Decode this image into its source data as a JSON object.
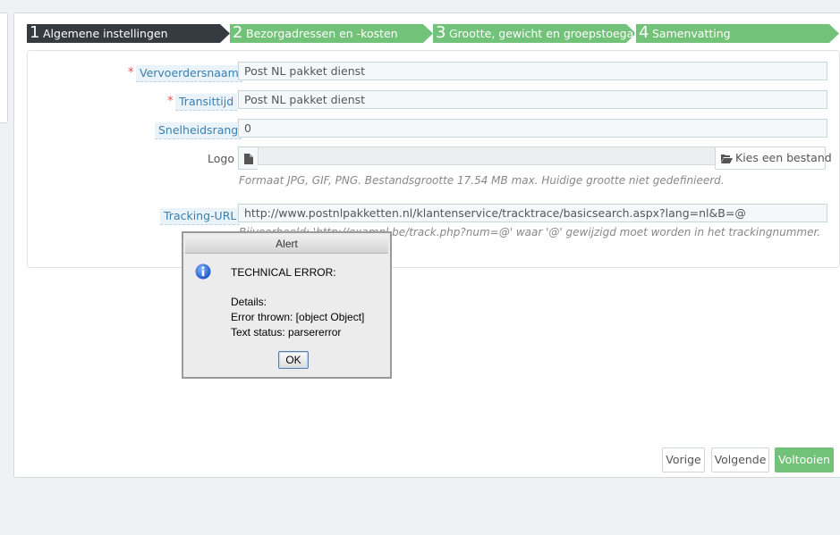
{
  "wizard": {
    "steps": [
      {
        "number": "1",
        "label": "Algemene instellingen",
        "state": "active"
      },
      {
        "number": "2",
        "label": "Bezorgadressen en -kosten",
        "state": "pending"
      },
      {
        "number": "3",
        "label": "Grootte, gewicht en groepstoegang",
        "state": "pending"
      },
      {
        "number": "4",
        "label": "Samenvatting",
        "state": "pending"
      }
    ]
  },
  "form": {
    "carrier_name": {
      "label": "Vervoerdersnaam",
      "required_mark": "*",
      "value": "Post NL pakket dienst"
    },
    "transit_time": {
      "label": "Transittijd",
      "required_mark": "*",
      "value": "Post NL pakket dienst"
    },
    "speed_grade": {
      "label": "Snelheidsrang",
      "value": "0"
    },
    "logo": {
      "label": "Logo",
      "button_label": "Kies een bestand",
      "help": "Formaat JPG, GIF, PNG. Bestandsgrootte 17.54 MB max. Huidige grootte niet gedefinieerd."
    },
    "tracking_url": {
      "label": "Tracking-URL",
      "value": "http://www.postnlpakketten.nl/klantenservice/tracktrace/basicsearch.aspx?lang=nl&B=@",
      "help": "Bijvoorbeeld: 'http://exampl.be/track.php?num=@' waar '@' gewijzigd moet worden in het trackingnummer."
    }
  },
  "footer": {
    "prev_label": "Vorige",
    "next_label": "Volgende",
    "finish_label": "Voltooien"
  },
  "alert": {
    "title": "Alert",
    "heading": "TECHNICAL ERROR:",
    "details_label": "Details:",
    "error_line": "Error thrown: [object Object]",
    "status_line": "Text status: parsererror",
    "ok_label": "OK"
  },
  "colors": {
    "step_active": "#363a41",
    "step_pending": "#72c279",
    "finish_button": "#72c279",
    "label_link": "#3b7fae",
    "required": "#e05252"
  }
}
